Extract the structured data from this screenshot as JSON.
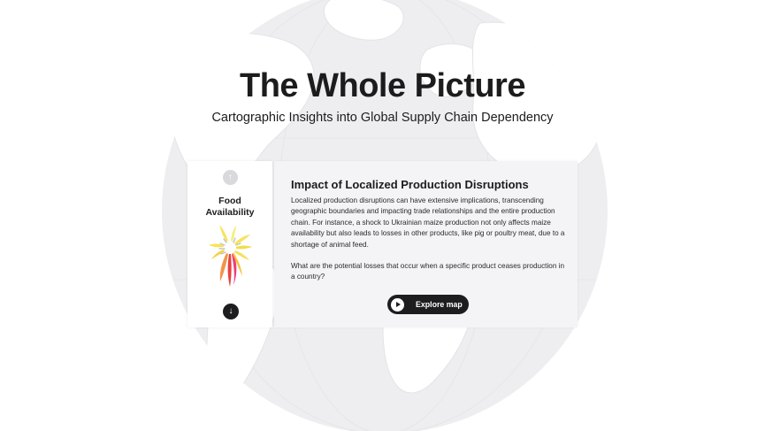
{
  "header": {
    "title": "The Whole Picture",
    "subtitle": "Cartographic Insights into Global Supply Chain Dependency"
  },
  "sidebar_card": {
    "label_line1": "Food",
    "label_line2": "Availability",
    "up_icon": "arrow-up-icon",
    "down_icon": "arrow-down-icon",
    "up_glyph": "↑",
    "down_glyph": "↓"
  },
  "content_card": {
    "title": "Impact of Localized Production Disruptions",
    "paragraph1": "Localized production disruptions can have extensive implications, transcending geographic boundaries and impacting trade relationships and the entire production chain. For instance, a shock to Ukrainian maize production not only affects maize availability but also leads to losses in other products, like pig or poultry meat, due to a shortage of animal feed.",
    "paragraph2": "What are the potential losses that occur when a specific product ceases production in a country?",
    "explore_button": "Explore map",
    "explore_icon": "play-icon"
  },
  "colors": {
    "globe": "#eeeef1",
    "land": "#ffffff",
    "card_bg": "#f4f4f6",
    "button_dark": "#1d1d1f",
    "petal_yellow": "#f6e45a",
    "petal_orange": "#f3934a",
    "petal_pink": "#ee3e7c",
    "petal_red": "#e8423f"
  }
}
